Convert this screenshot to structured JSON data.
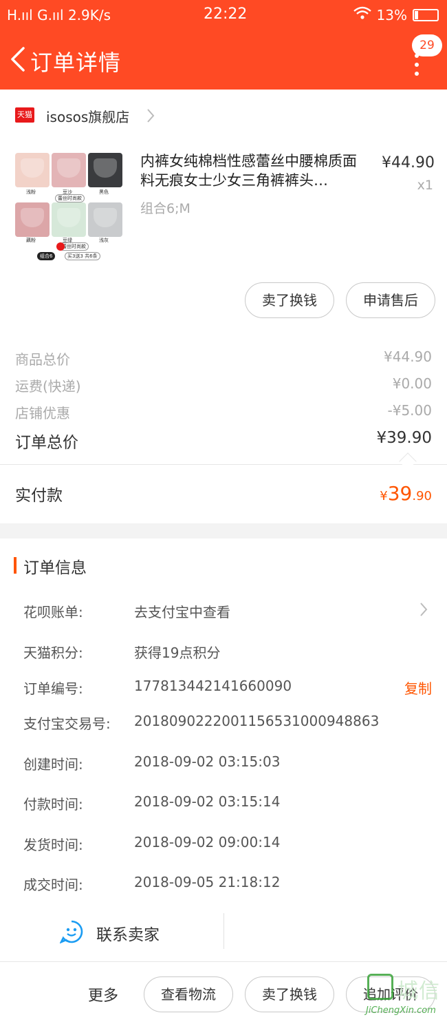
{
  "status_bar": {
    "left": "H.ııl G.ııl 2.9K/s",
    "time": "22:22",
    "battery": "13%"
  },
  "header": {
    "title": "订单详情",
    "badge": "29"
  },
  "shop": {
    "logo_text": "天猫",
    "name": "isosos旗舰店"
  },
  "product": {
    "name": "内裤女纯棉档性感蕾丝中腰棉质面料无痕女士少女三角裤裤头…",
    "spec": "组合6;M",
    "price": "¥44.90",
    "qty": "x1",
    "thumb_tags": {
      "t1": "浅粉",
      "t2": "豆沙",
      "t3": "黑色",
      "t4": "蕾丝时尚款",
      "t5": "藕粉",
      "t6": "豆绿",
      "t7": "浅灰",
      "t8": "蕾丝时尚款",
      "t9": "组合6",
      "t10": "买3送3 共6条"
    },
    "colors": [
      "#f2d2c8",
      "#e3b4b6",
      "#3a3b3e",
      "#dca6a8",
      "#d6e8d9",
      "#c9cbcd"
    ]
  },
  "item_actions": {
    "sell": "卖了换钱",
    "after_sale": "申请售后"
  },
  "summary": {
    "goods_total_label": "商品总价",
    "goods_total": "¥44.90",
    "shipping_label": "运费(快递)",
    "shipping": "¥0.00",
    "discount_label": "店铺优惠",
    "discount": "-¥5.00",
    "order_total_label": "订单总价",
    "order_total": "¥39.90",
    "paid_label": "实付款",
    "paid_symbol": "¥",
    "paid_int": "39",
    "paid_dec": ".90"
  },
  "order_info": {
    "title": "订单信息",
    "huabei_label": "花呗账单:",
    "huabei_value": "去支付宝中查看",
    "points_label": "天猫积分:",
    "points_value": "获得19点积分",
    "order_no_label": "订单编号:",
    "order_no": "177813442141660090",
    "copy": "复制",
    "alipay_label": "支付宝交易号:",
    "alipay_no": "2018090222001156531000948863",
    "created_label": "创建时间:",
    "created": "2018-09-02 03:15:03",
    "paid_time_label": "付款时间:",
    "paid_time": "2018-09-02 03:15:14",
    "shipped_label": "发货时间:",
    "shipped": "2018-09-02 09:00:14",
    "closed_label": "成交时间:",
    "closed": "2018-09-05 21:18:12"
  },
  "contact": {
    "label": "联系卖家"
  },
  "bottom": {
    "more": "更多",
    "logistics": "查看物流",
    "sell": "卖了换钱",
    "review": "追加评价"
  },
  "watermark": {
    "cn": "城信",
    "en": "JiChengXin.com"
  }
}
